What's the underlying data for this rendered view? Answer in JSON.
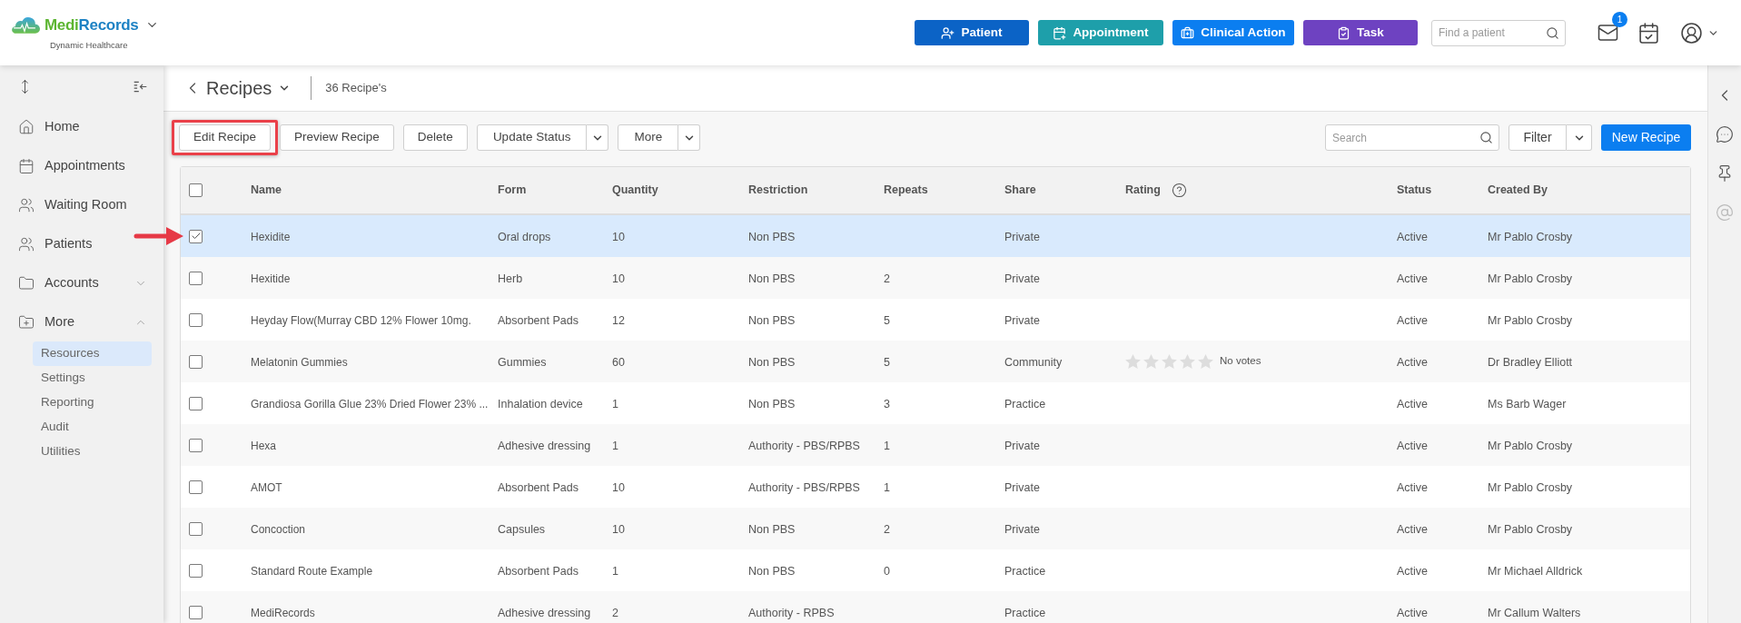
{
  "header": {
    "brand": {
      "prefix": "Medi",
      "suffix": "Records",
      "tagline": "Dynamic Healthcare"
    },
    "actions": [
      {
        "kind": "patient",
        "label": "Patient"
      },
      {
        "kind": "appointment",
        "label": "Appointment"
      },
      {
        "kind": "clinical",
        "label": "Clinical Action"
      },
      {
        "kind": "task",
        "label": "Task"
      }
    ],
    "patient_search": {
      "placeholder": "Find a patient"
    },
    "messages": {
      "badge": "1"
    }
  },
  "sidebar": {
    "items": [
      {
        "kind": "home",
        "label": "Home",
        "selected": false
      },
      {
        "kind": "calendar",
        "label": "Appointments",
        "selected": false
      },
      {
        "kind": "waiting",
        "label": "Waiting Room",
        "selected": false
      },
      {
        "kind": "people",
        "label": "Patients",
        "selected": false
      },
      {
        "kind": "folder",
        "label": "Accounts",
        "selected": false,
        "expanded": false
      },
      {
        "kind": "folder-plus",
        "label": "More",
        "selected": false,
        "expanded": true,
        "children": [
          {
            "label": "Resources",
            "selected": true
          },
          {
            "label": "Settings",
            "selected": false
          },
          {
            "label": "Reporting",
            "selected": false
          },
          {
            "label": "Audit",
            "selected": false
          },
          {
            "label": "Utilities",
            "selected": false
          }
        ]
      }
    ]
  },
  "page": {
    "title": "Recipes",
    "count": "36 Recipe's"
  },
  "toolbar": {
    "buttons": [
      {
        "kind": "plain",
        "label": "Edit Recipe",
        "highlighted": true
      },
      {
        "kind": "plain",
        "label": "Preview Recipe",
        "highlighted": false
      },
      {
        "kind": "plain",
        "label": "Delete",
        "highlighted": false
      },
      {
        "kind": "split",
        "label": "Update Status",
        "highlighted": false
      },
      {
        "kind": "split",
        "label": "More",
        "highlighted": false
      }
    ],
    "search": {
      "placeholder": "Search"
    },
    "filter": {
      "label": "Filter"
    },
    "create": {
      "label": "New Recipe"
    }
  },
  "table": {
    "select_all": {
      "checked": false
    },
    "columns": [
      {
        "label": "Name",
        "help": false
      },
      {
        "label": "Form",
        "help": false
      },
      {
        "label": "Quantity",
        "help": false
      },
      {
        "label": "Restriction",
        "help": false
      },
      {
        "label": "Repeats",
        "help": false
      },
      {
        "label": "Share",
        "help": false
      },
      {
        "label": "Rating",
        "help": true
      },
      {
        "label": "Status",
        "help": false
      },
      {
        "label": "Created By",
        "help": false
      }
    ],
    "rows": [
      {
        "selected": true,
        "arrow": true,
        "name": "Hexidite",
        "form": "Oral drops",
        "quantity": "10",
        "restriction": "Non PBS",
        "share": "Private",
        "status": "Active",
        "created_by": "Mr Pablo Crosby"
      },
      {
        "selected": false,
        "arrow": false,
        "name": "Hexitide",
        "form": "Herb",
        "quantity": "10",
        "restriction": "Non PBS",
        "repeats": "2",
        "share": "Private",
        "status": "Active",
        "created_by": "Mr Pablo Crosby"
      },
      {
        "selected": false,
        "arrow": false,
        "name": "Heyday Flow(Murray CBD 12% Flower 10mg.",
        "form": "Absorbent Pads",
        "quantity": "12",
        "restriction": "Non PBS",
        "repeats": "5",
        "share": "Private",
        "status": "Active",
        "created_by": "Mr Pablo Crosby"
      },
      {
        "selected": false,
        "arrow": false,
        "name": "Melatonin Gummies",
        "form": "Gummies",
        "quantity": "60",
        "restriction": "Non PBS",
        "repeats": "5",
        "share": "Community",
        "rating": {
          "stars": 0,
          "votes": "No votes"
        },
        "status": "Active",
        "created_by": "Dr Bradley Elliott"
      },
      {
        "selected": false,
        "arrow": false,
        "name": "Grandiosa Gorilla Glue 23% Dried Flower 23% ...",
        "form": "Inhalation device",
        "quantity": "1",
        "restriction": "Non PBS",
        "repeats": "3",
        "share": "Practice",
        "status": "Active",
        "created_by": "Ms Barb Wager"
      },
      {
        "selected": false,
        "arrow": false,
        "name": "Hexa",
        "form": "Adhesive dressing",
        "quantity": "1",
        "restriction": "Authority - PBS/RPBS",
        "repeats": "1",
        "share": "Private",
        "status": "Active",
        "created_by": "Mr Pablo Crosby"
      },
      {
        "selected": false,
        "arrow": false,
        "name": "AMOT",
        "form": "Absorbent Pads",
        "quantity": "10",
        "restriction": "Authority - PBS/RPBS",
        "repeats": "1",
        "share": "Private",
        "status": "Active",
        "created_by": "Mr Pablo Crosby"
      },
      {
        "selected": false,
        "arrow": false,
        "name": "Concoction",
        "form": "Capsules",
        "quantity": "10",
        "restriction": "Non PBS",
        "repeats": "2",
        "share": "Private",
        "status": "Active",
        "created_by": "Mr Pablo Crosby"
      },
      {
        "selected": false,
        "arrow": false,
        "name": "Standard Route Example",
        "form": "Absorbent Pads",
        "quantity": "1",
        "restriction": "Non PBS",
        "repeats": "0",
        "share": "Practice",
        "status": "Active",
        "created_by": "Mr Michael Alldrick"
      },
      {
        "selected": false,
        "arrow": false,
        "name": "MediRecords",
        "form": "Adhesive dressing",
        "quantity": "2",
        "restriction": "Authority - RPBS",
        "share": "Practice",
        "status": "Active",
        "created_by": "Mr Callum Walters"
      }
    ]
  }
}
